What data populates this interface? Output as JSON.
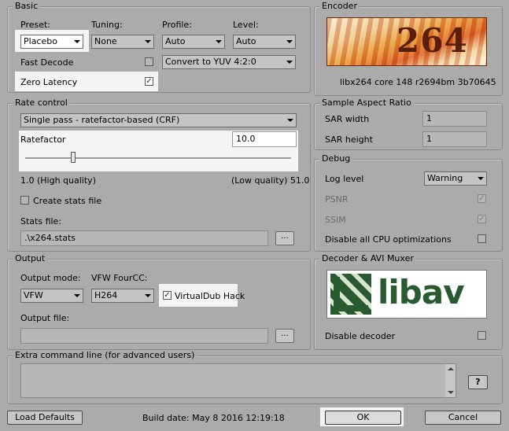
{
  "basic": {
    "title": "Basic",
    "preset": {
      "label": "Preset:",
      "value": "Placebo"
    },
    "tuning": {
      "label": "Tuning:",
      "value": "None"
    },
    "profile": {
      "label": "Profile:",
      "value": "Auto"
    },
    "level": {
      "label": "Level:",
      "value": "Auto"
    },
    "fast_decode": {
      "label": "Fast Decode",
      "checked": false
    },
    "colorspace": {
      "value": "Convert to YUV 4:2:0"
    },
    "zero_latency": {
      "label": "Zero Latency",
      "checked": true
    }
  },
  "encoder": {
    "title": "Encoder",
    "logo_text": "264",
    "version": "libx264 core 148 r2694bm 3b70645"
  },
  "rate_control": {
    "title": "Rate control",
    "mode": "Single pass - ratefactor-based (CRF)",
    "ratefactor_label": "Ratefactor",
    "ratefactor_value": "10.0",
    "slider_fraction": 0.18,
    "min_label": "1.0 (High quality)",
    "max_label": "(Low quality) 51.0",
    "create_stats": {
      "label": "Create stats file",
      "checked": false
    },
    "stats_file_label": "Stats file:",
    "stats_file_value": ".\\x264.stats",
    "browse_label": "..."
  },
  "sar": {
    "title": "Sample Aspect Ratio",
    "width_label": "SAR width",
    "width_value": "1",
    "height_label": "SAR height",
    "height_value": "1"
  },
  "debug": {
    "title": "Debug",
    "log_level_label": "Log level",
    "log_level_value": "Warning",
    "psnr": {
      "label": "PSNR",
      "checked": true
    },
    "ssim": {
      "label": "SSIM",
      "checked": true
    },
    "disable_cpu": {
      "label": "Disable all CPU optimizations",
      "checked": false
    }
  },
  "output": {
    "title": "Output",
    "mode_label": "Output mode:",
    "mode_value": "VFW",
    "fourcc_label": "VFW FourCC:",
    "fourcc_value": "H264",
    "vdub_hack": {
      "label": "VirtualDub Hack",
      "checked": true
    },
    "file_label": "Output file:",
    "file_value": "",
    "browse_label": "..."
  },
  "decoder": {
    "title": "Decoder & AVI Muxer",
    "logo_text": "libav",
    "disable_decoder": {
      "label": "Disable decoder",
      "checked": false
    }
  },
  "extra": {
    "title": "Extra command line (for advanced users)",
    "value": "",
    "help_label": "?"
  },
  "footer": {
    "load_defaults": "Load Defaults",
    "build_date": "Build date: May  8 2016 12:19:18",
    "ok": "OK",
    "cancel": "Cancel"
  },
  "colors": {
    "background": "#ababab",
    "x264_logo_red": "#b0201c",
    "libav_logo_green": "#2a5a2f"
  }
}
